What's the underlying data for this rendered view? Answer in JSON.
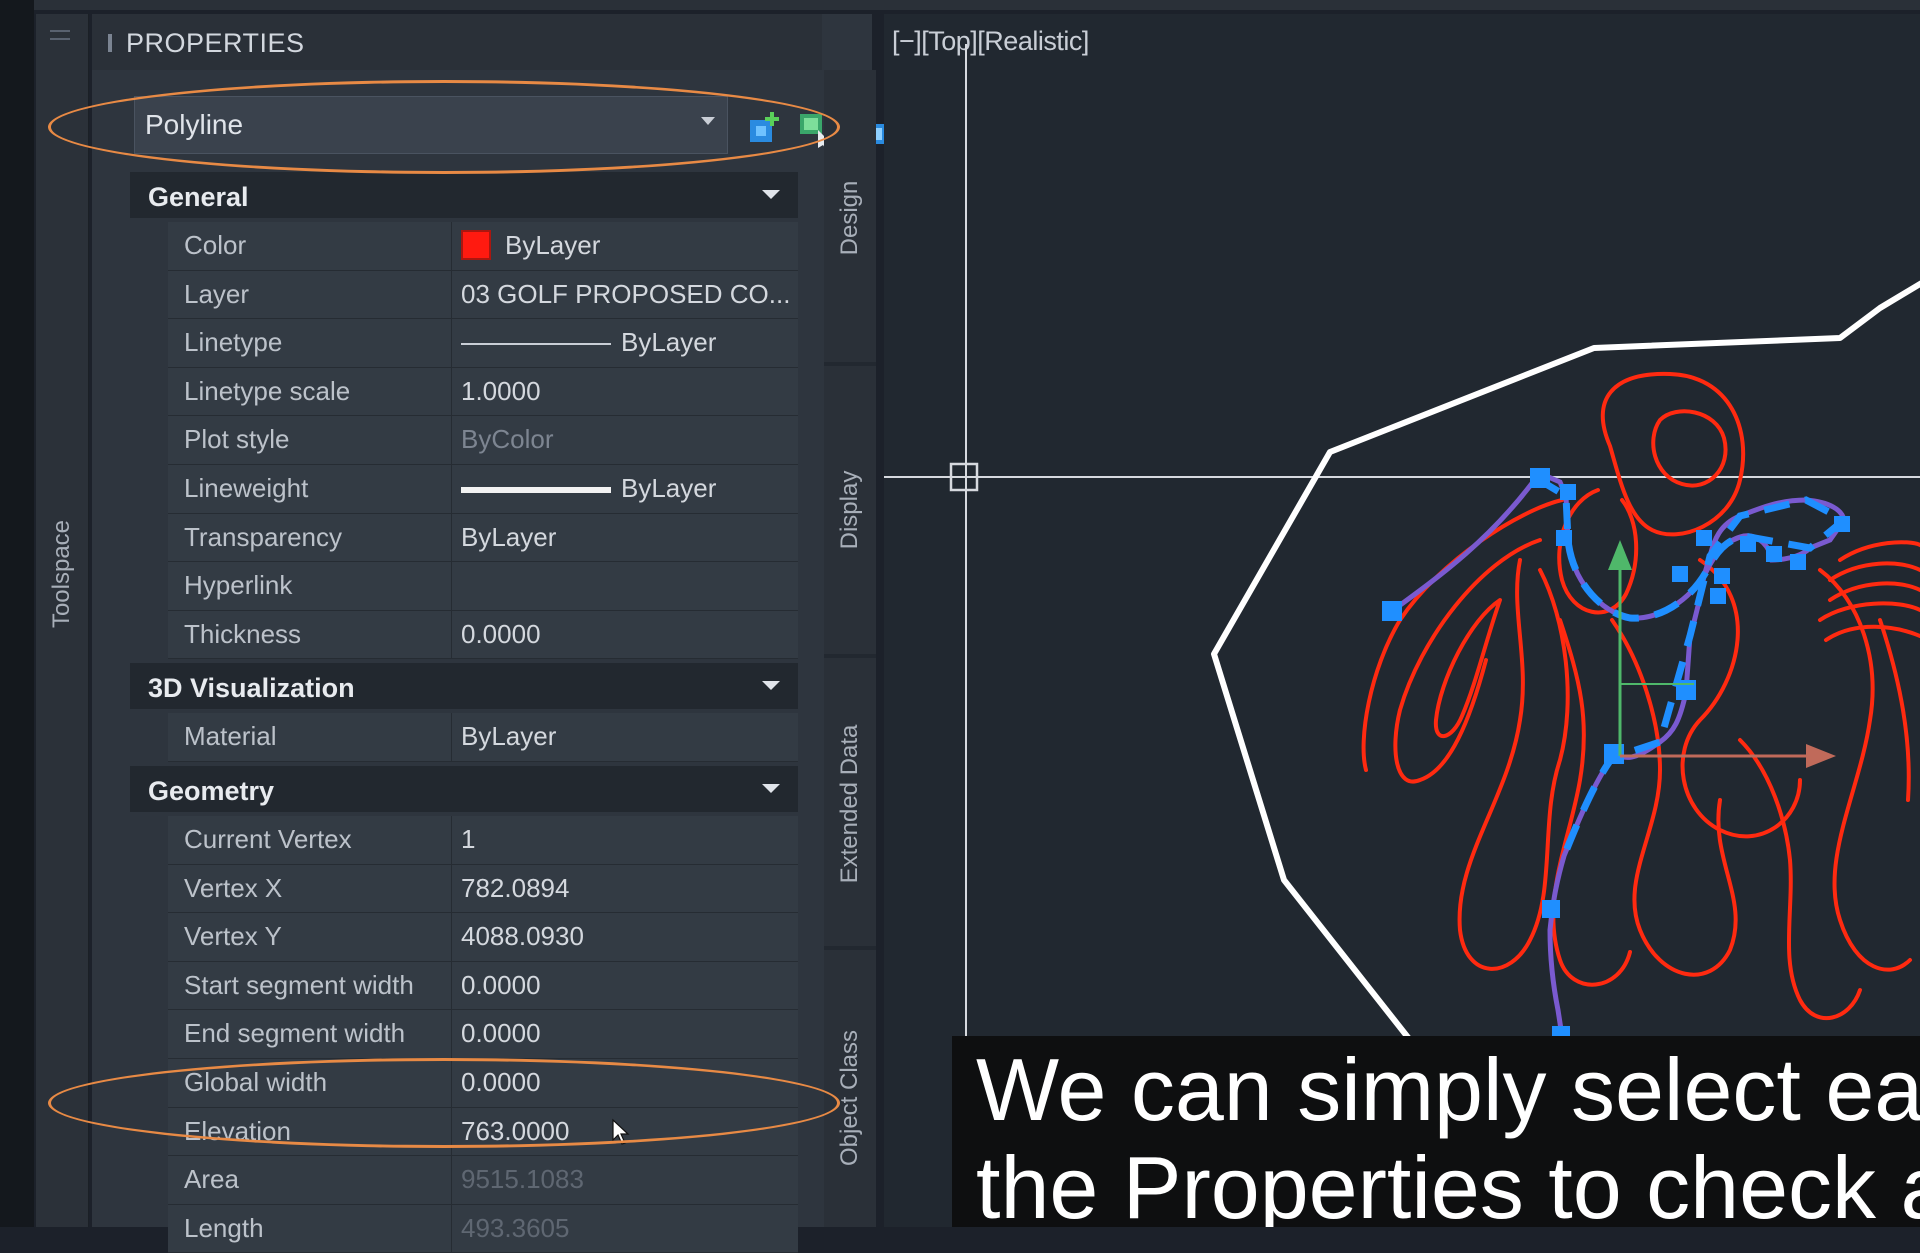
{
  "toolspace": {
    "label": "Toolspace"
  },
  "panel": {
    "title": "PROPERTIES",
    "selector": {
      "value": "Polyline"
    },
    "toolbar": [
      {
        "name": "add-to-selection-icon"
      },
      {
        "name": "quick-select-icon"
      },
      {
        "name": "select-objects-icon"
      }
    ],
    "sections": {
      "general": {
        "title": "General",
        "rows": [
          {
            "key": "Color",
            "value": "ByLayer"
          },
          {
            "key": "Layer",
            "value": "03 GOLF PROPOSED CO..."
          },
          {
            "key": "Linetype",
            "value": "ByLayer"
          },
          {
            "key": "Linetype scale",
            "value": "1.0000"
          },
          {
            "key": "Plot style",
            "value": "ByColor"
          },
          {
            "key": "Lineweight",
            "value": "ByLayer"
          },
          {
            "key": "Transparency",
            "value": "ByLayer"
          },
          {
            "key": "Hyperlink",
            "value": ""
          },
          {
            "key": "Thickness",
            "value": "0.0000"
          }
        ]
      },
      "viz3d": {
        "title": "3D Visualization",
        "rows": [
          {
            "key": "Material",
            "value": "ByLayer"
          }
        ]
      },
      "geometry": {
        "title": "Geometry",
        "rows": [
          {
            "key": "Current Vertex",
            "value": "1"
          },
          {
            "key": "Vertex X",
            "value": "782.0894"
          },
          {
            "key": "Vertex Y",
            "value": "4088.0930"
          },
          {
            "key": "Start segment width",
            "value": "0.0000"
          },
          {
            "key": "End segment width",
            "value": "0.0000"
          },
          {
            "key": "Global width",
            "value": "0.0000"
          },
          {
            "key": "Elevation",
            "value": "763.0000"
          },
          {
            "key": "Area",
            "value": "9515.1083"
          },
          {
            "key": "Length",
            "value": "493.3605"
          }
        ]
      }
    },
    "side_tabs": [
      "Design",
      "Display",
      "Extended Data",
      "Object Class"
    ]
  },
  "viewport": {
    "label": "[−][Top][Realistic]"
  },
  "caption": {
    "line1": "We can simply select eac",
    "line2": "the Properties to check a"
  },
  "colors": {
    "highlight": "#e88a45",
    "contour": "#ff2a10",
    "boundary": "#ffffff",
    "grip": "#1f8fff"
  }
}
